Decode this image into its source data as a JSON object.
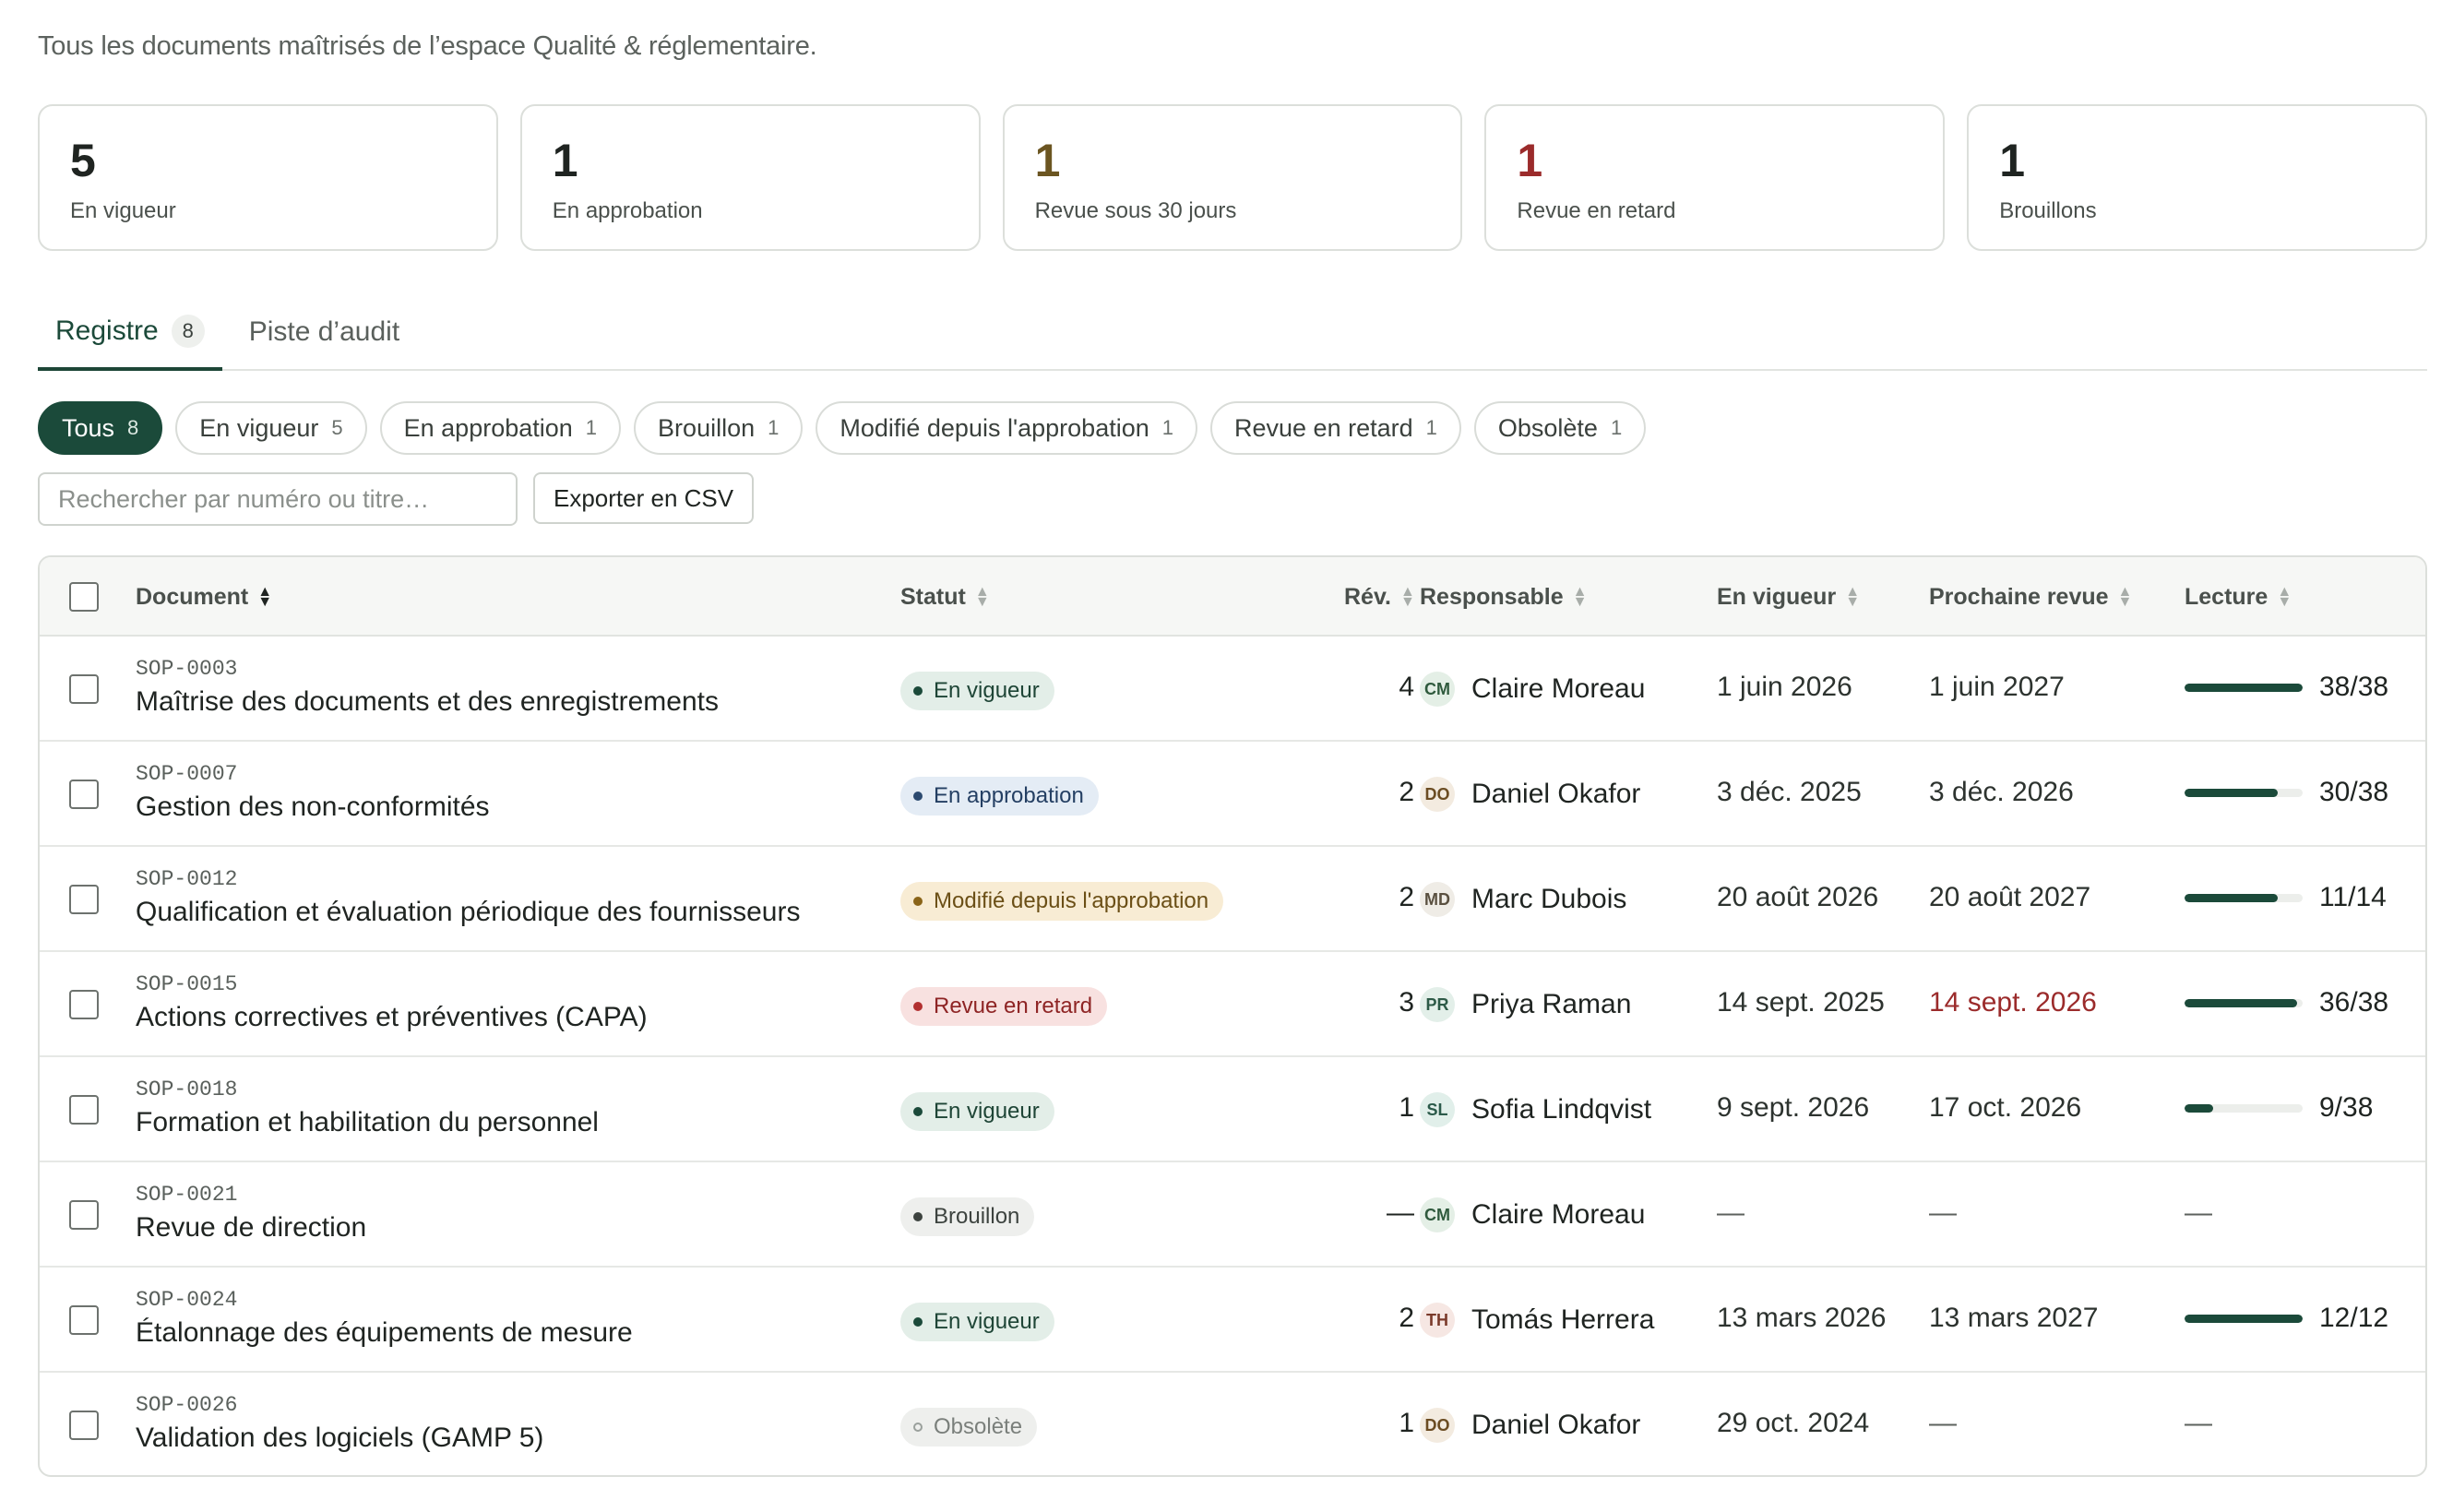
{
  "subtitle": "Tous les documents maîtrisés de l’espace Qualité & réglementaire.",
  "stats": [
    {
      "value": "5",
      "label": "En vigueur",
      "color": "#1f2421"
    },
    {
      "value": "1",
      "label": "En approbation",
      "color": "#1f2421"
    },
    {
      "value": "1",
      "label": "Revue sous 30 jours",
      "color": "#6b5521"
    },
    {
      "value": "1",
      "label": "Revue en retard",
      "color": "#9b2b2b"
    },
    {
      "value": "1",
      "label": "Brouillons",
      "color": "#1f2421"
    }
  ],
  "tabs": [
    {
      "label": "Registre",
      "count": "8"
    },
    {
      "label": "Piste d’audit"
    }
  ],
  "filters": [
    {
      "label": "Tous",
      "count": "8"
    },
    {
      "label": "En vigueur",
      "count": "5"
    },
    {
      "label": "En approbation",
      "count": "1"
    },
    {
      "label": "Brouillon",
      "count": "1"
    },
    {
      "label": "Modifié depuis l'approbation",
      "count": "1"
    },
    {
      "label": "Revue en retard",
      "count": "1"
    },
    {
      "label": "Obsolète",
      "count": "1"
    }
  ],
  "search": {
    "placeholder": "Rechercher par numéro ou titre…"
  },
  "export_label": "Exporter en CSV",
  "columns": {
    "document": "Document",
    "status": "Statut",
    "rev": "Rév.",
    "owner": "Responsable",
    "effective": "En vigueur",
    "next_review": "Prochaine revue",
    "reading": "Lecture"
  },
  "status_styles": {
    "active": {
      "bg": "#e3eee8",
      "fg": "#1e4536",
      "dot": "#1b4a3a"
    },
    "approval": {
      "bg": "#e4ecf5",
      "fg": "#243f63",
      "dot": "#2c4a70"
    },
    "modified": {
      "bg": "#f8ecd4",
      "fg": "#6b4f16",
      "dot": "#8a6418"
    },
    "overdue": {
      "bg": "#f8e1e0",
      "fg": "#8e2424",
      "dot": "#b23030"
    },
    "draft": {
      "bg": "#eeefed",
      "fg": "#3d433f",
      "dot": "#3d433f"
    },
    "obsolete": {
      "bg": "#eeefed",
      "fg": "#7a7f7b",
      "dot": "#9aa09c"
    }
  },
  "rows": [
    {
      "number": "SOP-0003",
      "title": "Maîtrise des documents et des enregistrements",
      "status": "En vigueur",
      "status_kind": "active",
      "rev": "4",
      "initials": "CM",
      "owner": "Claire Moreau",
      "avatar_bg": "#e4efe6",
      "avatar_fg": "#2f5a3d",
      "effective": "1 juin 2026",
      "next_review": "1 juin 2027",
      "next_late": false,
      "reading": "38/38",
      "read_fraction": 1.0
    },
    {
      "number": "SOP-0007",
      "title": "Gestion des non-conformités",
      "status": "En approbation",
      "status_kind": "approval",
      "rev": "2",
      "initials": "DO",
      "owner": "Daniel Okafor",
      "avatar_bg": "#f3ebe0",
      "avatar_fg": "#6b4c22",
      "effective": "3 déc. 2025",
      "next_review": "3 déc. 2026",
      "next_late": false,
      "reading": "30/38",
      "read_fraction": 0.79
    },
    {
      "number": "SOP-0012",
      "title": "Qualification et évaluation périodique des fournisseurs",
      "status": "Modifié depuis l'approbation",
      "status_kind": "modified",
      "rev": "2",
      "initials": "MD",
      "owner": "Marc Dubois",
      "avatar_bg": "#efece6",
      "avatar_fg": "#5a5040",
      "effective": "20 août 2026",
      "next_review": "20 août 2027",
      "next_late": false,
      "reading": "11/14",
      "read_fraction": 0.79
    },
    {
      "number": "SOP-0015",
      "title": "Actions correctives et préventives (CAPA)",
      "status": "Revue en retard",
      "status_kind": "overdue",
      "rev": "3",
      "initials": "PR",
      "owner": "Priya Raman",
      "avatar_bg": "#e3efe9",
      "avatar_fg": "#2d5a47",
      "effective": "14 sept. 2025",
      "next_review": "14 sept. 2026",
      "next_late": true,
      "reading": "36/38",
      "read_fraction": 0.95
    },
    {
      "number": "SOP-0018",
      "title": "Formation et habilitation du personnel",
      "status": "En vigueur",
      "status_kind": "active",
      "rev": "1",
      "initials": "SL",
      "owner": "Sofia Lindqvist",
      "avatar_bg": "#e1efea",
      "avatar_fg": "#2b5a4a",
      "effective": "9 sept. 2026",
      "next_review": "17 oct. 2026",
      "next_late": false,
      "reading": "9/38",
      "read_fraction": 0.24
    },
    {
      "number": "SOP-0021",
      "title": "Revue de direction",
      "status": "Brouillon",
      "status_kind": "draft",
      "rev": "—",
      "initials": "CM",
      "owner": "Claire Moreau",
      "avatar_bg": "#e4efe6",
      "avatar_fg": "#2f5a3d",
      "effective": "—",
      "next_review": "—",
      "next_late": false,
      "reading": "—",
      "read_fraction": null
    },
    {
      "number": "SOP-0024",
      "title": "Étalonnage des équipements de mesure",
      "status": "En vigueur",
      "status_kind": "active",
      "rev": "2",
      "initials": "TH",
      "owner": "Tomás Herrera",
      "avatar_bg": "#f6e7e3",
      "avatar_fg": "#7a3a2a",
      "effective": "13 mars 2026",
      "next_review": "13 mars 2027",
      "next_late": false,
      "reading": "12/12",
      "read_fraction": 1.0
    },
    {
      "number": "SOP-0026",
      "title": "Validation des logiciels (GAMP 5)",
      "status": "Obsolète",
      "status_kind": "obsolete",
      "rev": "1",
      "initials": "DO",
      "owner": "Daniel Okafor",
      "avatar_bg": "#f3ebe0",
      "avatar_fg": "#6b4c22",
      "effective": "29 oct. 2024",
      "next_review": "—",
      "next_late": false,
      "reading": "—",
      "read_fraction": null
    }
  ]
}
